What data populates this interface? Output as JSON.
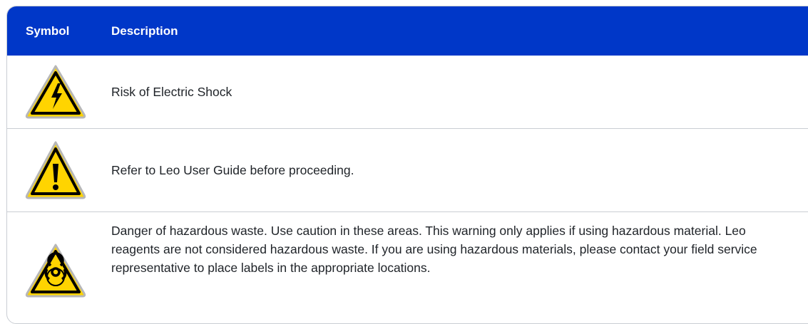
{
  "table": {
    "columns": [
      "Symbol",
      "Description"
    ],
    "rows": [
      {
        "icon": "electric-shock-warning-icon",
        "description": "Risk of Electric Shock"
      },
      {
        "icon": "general-warning-icon",
        "description": "Refer to Leo User Guide before proceeding."
      },
      {
        "icon": "biohazard-warning-icon",
        "description": "Danger of hazardous waste. Use caution in these areas. This warning only applies if using hazardous material. Leo reagents are not considered hazardous waste. If you are using hazardous materials, please contact your field service representative to place labels in the appropriate locations."
      }
    ]
  },
  "colors": {
    "header_bg": "#0037c8",
    "header_text": "#ffffff",
    "warning_yellow": "#ffd400",
    "border": "#c9cdd3"
  }
}
